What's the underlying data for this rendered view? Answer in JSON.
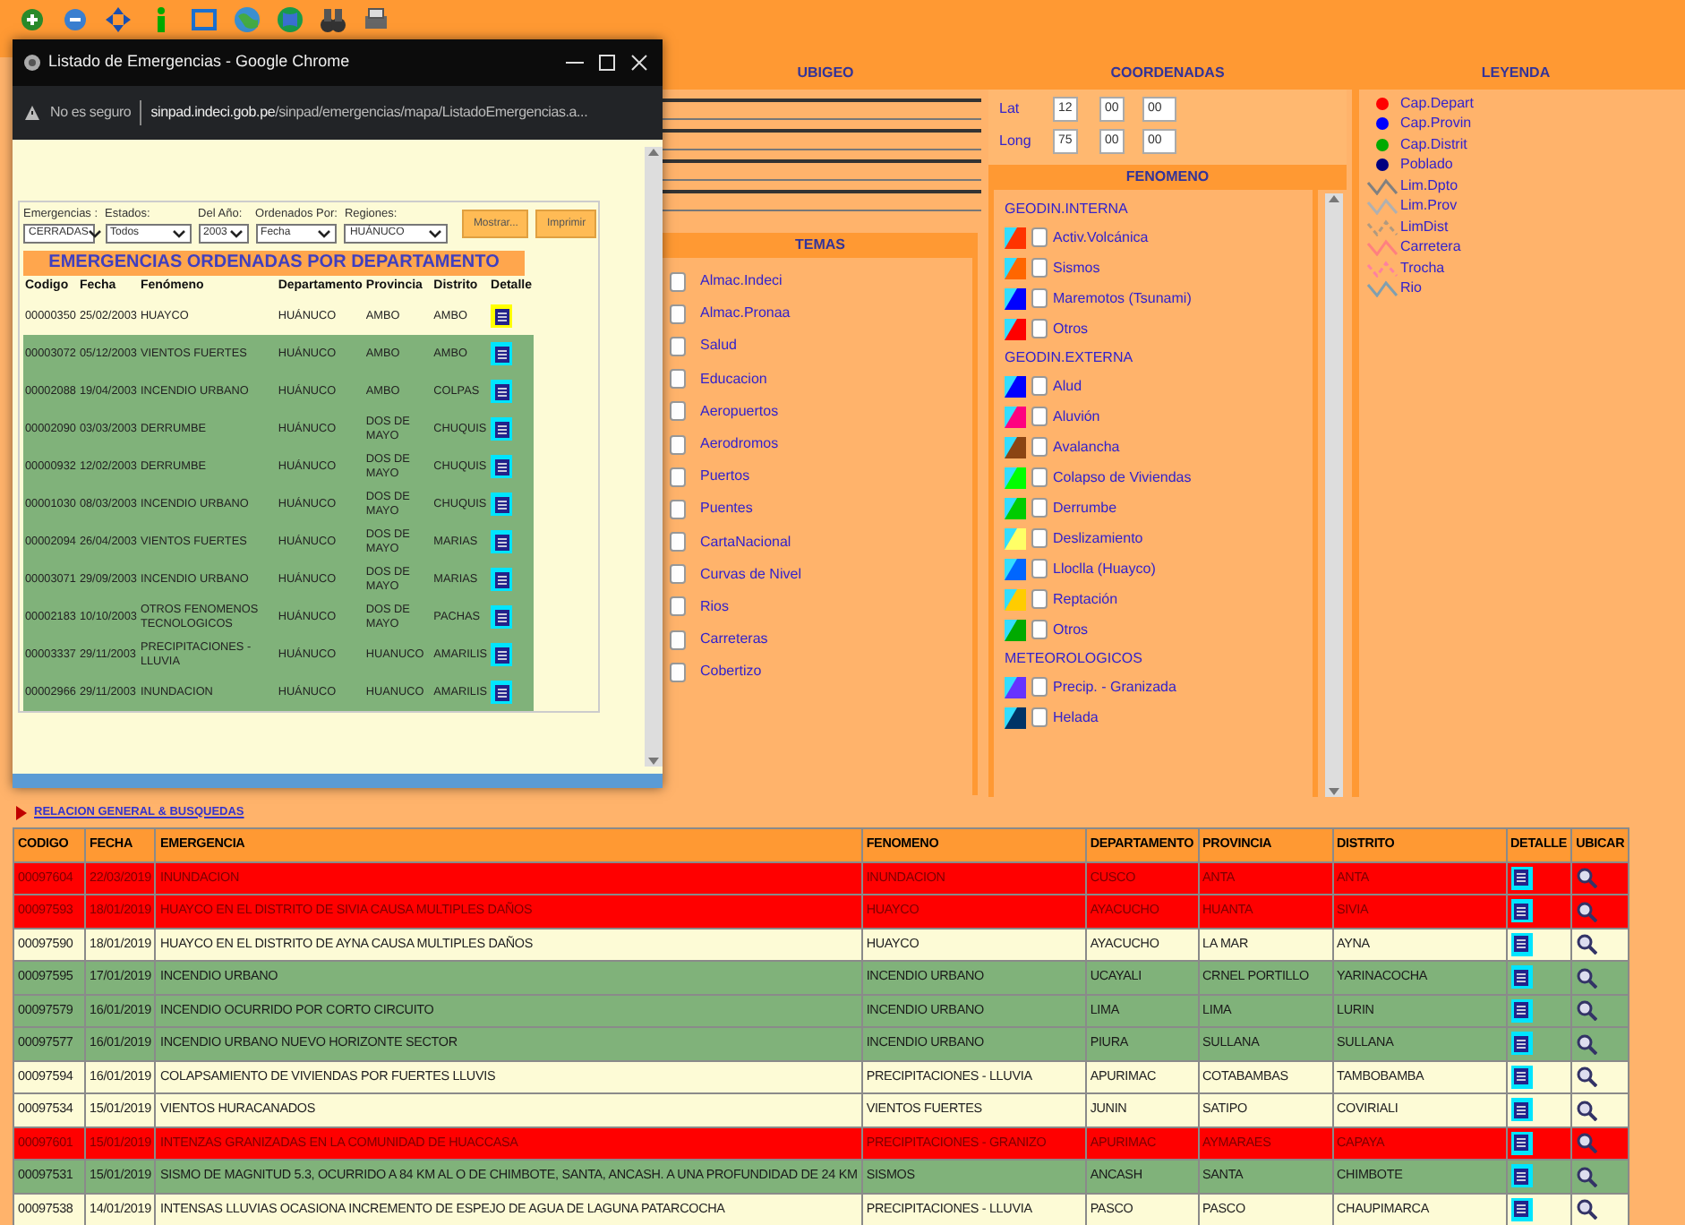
{
  "popup": {
    "title": "Listado de Emergencias - Google Chrome",
    "security": "No es seguro",
    "url_host": "sinpad.indeci.gob.pe",
    "url_path": "/sinpad/emergencias/mapa/ListadoEmergencias.a...",
    "filters": [
      {
        "label": "Emergencias :",
        "value": "CERRADAS"
      },
      {
        "label": "Estados:",
        "value": "Todos"
      },
      {
        "label": "Del Año:",
        "value": "2003"
      },
      {
        "label": "Ordenados Por:",
        "value": "Fecha"
      },
      {
        "label": "Regiones:",
        "value": "HUÁNUCO"
      }
    ],
    "buttons": [
      "Mostrar...",
      "Imprimir"
    ],
    "heading": "EMERGENCIAS ORDENADAS POR DEPARTAMENTO",
    "columns": [
      "Codigo",
      "Fecha",
      "Fenómeno",
      "Departamento",
      "Provincia",
      "Distrito",
      "Detalle"
    ],
    "rows": [
      {
        "selected": true,
        "cells": [
          "00000350",
          "25/02/2003",
          "HUAYCO",
          "HUÁNUCO",
          "AMBO",
          "AMBO"
        ]
      },
      {
        "selected": false,
        "cells": [
          "00003072",
          "05/12/2003",
          "VIENTOS FUERTES",
          "HUÁNUCO",
          "AMBO",
          "AMBO"
        ]
      },
      {
        "selected": false,
        "cells": [
          "00002088",
          "19/04/2003",
          "INCENDIO URBANO",
          "HUÁNUCO",
          "AMBO",
          "COLPAS"
        ]
      },
      {
        "selected": false,
        "cells": [
          "00002090",
          "03/03/2003",
          "DERRUMBE",
          "HUÁNUCO",
          "DOS DE MAYO",
          "CHUQUIS"
        ]
      },
      {
        "selected": false,
        "cells": [
          "00000932",
          "12/02/2003",
          "DERRUMBE",
          "HUÁNUCO",
          "DOS DE MAYO",
          "CHUQUIS"
        ]
      },
      {
        "selected": false,
        "cells": [
          "00001030",
          "08/03/2003",
          "INCENDIO URBANO",
          "HUÁNUCO",
          "DOS DE MAYO",
          "CHUQUIS"
        ]
      },
      {
        "selected": false,
        "cells": [
          "00002094",
          "26/04/2003",
          "VIENTOS FUERTES",
          "HUÁNUCO",
          "DOS DE MAYO",
          "MARIAS"
        ]
      },
      {
        "selected": false,
        "cells": [
          "00003071",
          "29/09/2003",
          "INCENDIO URBANO",
          "HUÁNUCO",
          "DOS DE MAYO",
          "MARIAS"
        ]
      },
      {
        "selected": false,
        "cells": [
          "00002183",
          "10/10/2003",
          "OTROS FENOMENOS TECNOLOGICOS",
          "HUÁNUCO",
          "DOS DE MAYO",
          "PACHAS"
        ]
      },
      {
        "selected": false,
        "cells": [
          "00003337",
          "29/11/2003",
          "PRECIPITACIONES - LLUVIA",
          "HUÁNUCO",
          "HUANUCO",
          "AMARILIS"
        ]
      },
      {
        "selected": false,
        "cells": [
          "00002966",
          "29/11/2003",
          "INUNDACION",
          "HUÁNUCO",
          "HUANUCO",
          "AMARILIS"
        ]
      }
    ]
  },
  "ubigeo": {
    "title": "UBIGEO"
  },
  "coordenadas": {
    "title": "COORDENADAS",
    "rows": [
      {
        "label": "Lat",
        "values": [
          "12",
          "00",
          "00"
        ]
      },
      {
        "label": "Long",
        "values": [
          "75",
          "00",
          "00"
        ]
      }
    ]
  },
  "temas": {
    "title": "TEMAS",
    "items": [
      {
        "label": "Almac.Indeci",
        "checked": false
      },
      {
        "label": "Almac.Pronaa",
        "checked": false
      },
      {
        "label": "Salud",
        "checked": false
      },
      {
        "label": "Educacion",
        "checked": false
      },
      {
        "label": "Aeropuertos",
        "checked": false
      },
      {
        "label": "Aerodromos",
        "checked": false
      },
      {
        "label": "Puertos",
        "checked": false
      },
      {
        "label": "Puentes",
        "checked": false
      },
      {
        "label": "CartaNacional",
        "checked": false
      },
      {
        "label": "Curvas de Nivel",
        "checked": false
      },
      {
        "label": "Rios",
        "checked": false
      },
      {
        "label": "Carreteras",
        "checked": false
      },
      {
        "label": "Cobertizo",
        "checked": false
      }
    ]
  },
  "fenomeno": {
    "title": "FENOMENO",
    "items": [
      {
        "kind": "group",
        "label": "GEODIN.INTERNA"
      },
      {
        "kind": "option",
        "label": "Activ.Volcánica",
        "checked": false,
        "color": "#ff3300"
      },
      {
        "kind": "option",
        "label": "Sismos",
        "checked": false,
        "color": "#ff6600"
      },
      {
        "kind": "option",
        "label": "Maremotos (Tsunami)",
        "checked": false,
        "color": "#0000ff"
      },
      {
        "kind": "option",
        "label": "Otros",
        "checked": false,
        "color": "#ff0000"
      },
      {
        "kind": "group",
        "label": "GEODIN.EXTERNA"
      },
      {
        "kind": "option",
        "label": "Alud",
        "checked": false,
        "color": "#0000ff"
      },
      {
        "kind": "option",
        "label": "Aluvión",
        "checked": false,
        "color": "#ff0080"
      },
      {
        "kind": "option",
        "label": "Avalancha",
        "checked": false,
        "color": "#8b4513"
      },
      {
        "kind": "option",
        "label": "Colapso de Viviendas",
        "checked": false,
        "color": "#00ff00"
      },
      {
        "kind": "option",
        "label": "Derrumbe",
        "checked": false,
        "color": "#00cc00"
      },
      {
        "kind": "option",
        "label": "Deslizamiento",
        "checked": false,
        "color": "#ffff66"
      },
      {
        "kind": "option",
        "label": "Lloclla (Huayco)",
        "checked": false,
        "color": "#0066ff"
      },
      {
        "kind": "option",
        "label": "Reptación",
        "checked": false,
        "color": "#ffcc00"
      },
      {
        "kind": "option",
        "label": "Otros",
        "checked": false,
        "color": "#00aa00"
      },
      {
        "kind": "group",
        "label": "METEOROLOGICOS"
      },
      {
        "kind": "option",
        "label": "Precip. - Granizada",
        "checked": false,
        "color": "#6633ff"
      },
      {
        "kind": "option",
        "label": "Helada",
        "checked": false,
        "color": "#003366"
      }
    ]
  },
  "leyenda": {
    "title": "LEYENDA",
    "items": [
      {
        "kind": "dot",
        "label": "Cap.Depart",
        "color": "#ff0000"
      },
      {
        "kind": "dot",
        "label": "Cap.Provin",
        "color": "#0000ff"
      },
      {
        "kind": "dot",
        "label": "Cap.Distrit",
        "color": "#00aa00"
      },
      {
        "kind": "dot",
        "label": "Poblado",
        "color": "#000080"
      },
      {
        "kind": "line",
        "label": "Lim.Dpto",
        "color": "#808080"
      },
      {
        "kind": "line",
        "label": "Lim.Prov",
        "color": "#b0b0b0"
      },
      {
        "kind": "dashed",
        "label": "LimDist",
        "color": "#b09a80"
      },
      {
        "kind": "line",
        "label": "Carretera",
        "color": "#ff8080"
      },
      {
        "kind": "dashed",
        "label": "Trocha",
        "color": "#ff80a0"
      },
      {
        "kind": "line",
        "label": "Rio",
        "color": "#7f9fb0"
      }
    ]
  },
  "link": "RELACION GENERAL & BUSQUEDAS",
  "emergencias": {
    "columns": [
      "CODIGO",
      "FECHA",
      "EMERGENCIA",
      "FENOMENO",
      "DEPARTAMENTO",
      "PROVINCIA",
      "DISTRITO",
      "DETALLE",
      "UBICAR"
    ],
    "rows": [
      {
        "kind": "alert",
        "cells": [
          "00097604",
          "22/03/2019",
          "INUNDACION",
          "INUNDACION",
          "CUSCO",
          "ANTA",
          "ANTA"
        ]
      },
      {
        "kind": "alert",
        "cells": [
          "00097593",
          "18/01/2019",
          "HUAYCO EN EL DISTRITO DE SIVIA CAUSA MULTIPLES DAÑOS",
          "HUAYCO",
          "AYACUCHO",
          "HUANTA",
          "SIVIA"
        ]
      },
      {
        "kind": "open",
        "cells": [
          "00097590",
          "18/01/2019",
          "HUAYCO EN EL DISTRITO DE AYNA CAUSA MULTIPLES DAÑOS",
          "HUAYCO",
          "AYACUCHO",
          "LA MAR",
          "AYNA"
        ]
      },
      {
        "kind": "closed",
        "cells": [
          "00097595",
          "17/01/2019",
          "INCENDIO URBANO",
          "INCENDIO URBANO",
          "UCAYALI",
          "CRNEL PORTILLO",
          "YARINACOCHA"
        ]
      },
      {
        "kind": "closed",
        "cells": [
          "00097579",
          "16/01/2019",
          "INCENDIO OCURRIDO POR CORTO CIRCUITO",
          "INCENDIO URBANO",
          "LIMA",
          "LIMA",
          "LURIN"
        ]
      },
      {
        "kind": "closed",
        "cells": [
          "00097577",
          "16/01/2019",
          "INCENDIO URBANO NUEVO HORIZONTE SECTOR",
          "INCENDIO URBANO",
          "PIURA",
          "SULLANA",
          "SULLANA"
        ]
      },
      {
        "kind": "open",
        "cells": [
          "00097594",
          "16/01/2019",
          "COLAPSAMIENTO DE VIVIENDAS POR FUERTES LLUVIS",
          "PRECIPITACIONES - LLUVIA",
          "APURIMAC",
          "COTABAMBAS",
          "TAMBOBAMBA"
        ]
      },
      {
        "kind": "open",
        "cells": [
          "00097534",
          "15/01/2019",
          "VIENTOS HURACANADOS",
          "VIENTOS FUERTES",
          "JUNIN",
          "SATIPO",
          "COVIRIALI"
        ]
      },
      {
        "kind": "alert",
        "cells": [
          "00097601",
          "15/01/2019",
          "INTENZAS GRANIZADAS EN LA COMUNIDAD DE HUACCASA",
          "PRECIPITACIONES - GRANIZO",
          "APURIMAC",
          "AYMARAES",
          "CAPAYA"
        ]
      },
      {
        "kind": "closed",
        "cells": [
          "00097531",
          "15/01/2019",
          "SISMO DE MAGNITUD 5.3, OCURRIDO A 84 KM AL O DE CHIMBOTE, SANTA, ANCASH. A UNA PROFUNDIDAD DE 24 KM",
          "SISMOS",
          "ANCASH",
          "SANTA",
          "CHIMBOTE"
        ]
      },
      {
        "kind": "open",
        "cells": [
          "00097538",
          "14/01/2019",
          "INTENSAS LLUVIAS OCASIONA INCREMENTO DE ESPEJO DE AGUA DE LAGUNA PATARCOCHA",
          "PRECIPITACIONES - LLUVIA",
          "PASCO",
          "PASCO",
          "CHAUPIMARCA"
        ]
      }
    ]
  }
}
